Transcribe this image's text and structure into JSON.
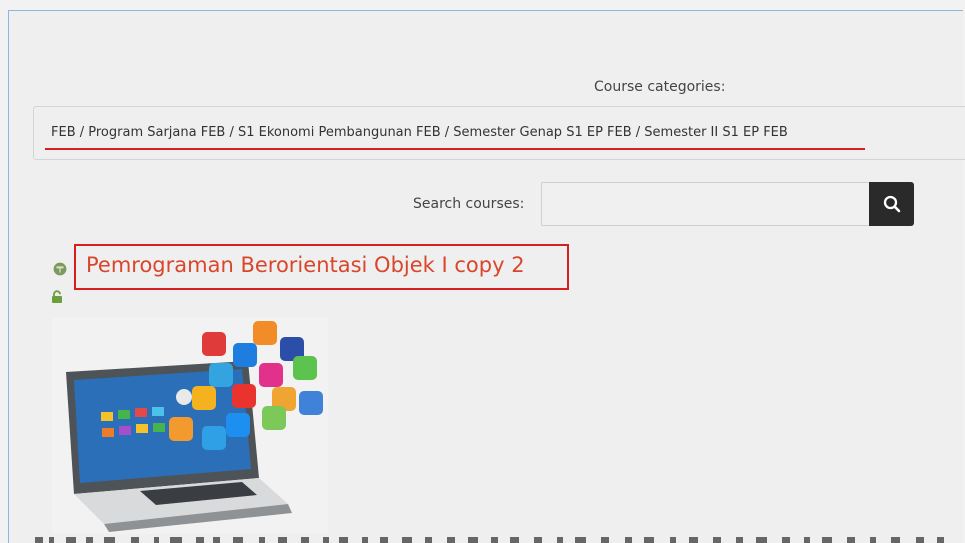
{
  "filters": {
    "category_label": "Course categories:",
    "category_value": "FEB / Program Sarjana FEB / S1 Ekonomi Pembangunan FEB / Semester Genap S1 EP FEB / Semester II S1 EP FEB",
    "search_label": "Search courses:",
    "search_value": ""
  },
  "course": {
    "title": "Pemrograman Berorientasi Objek I copy 2",
    "image_alt": "laptop-with-app-icons"
  },
  "colors": {
    "accent_red": "#d61f1f",
    "title_color": "#d9462b",
    "search_button": "#2a2a2a"
  },
  "icons": {
    "course": "course-icon",
    "lock": "unlock-icon",
    "search": "search-icon"
  }
}
